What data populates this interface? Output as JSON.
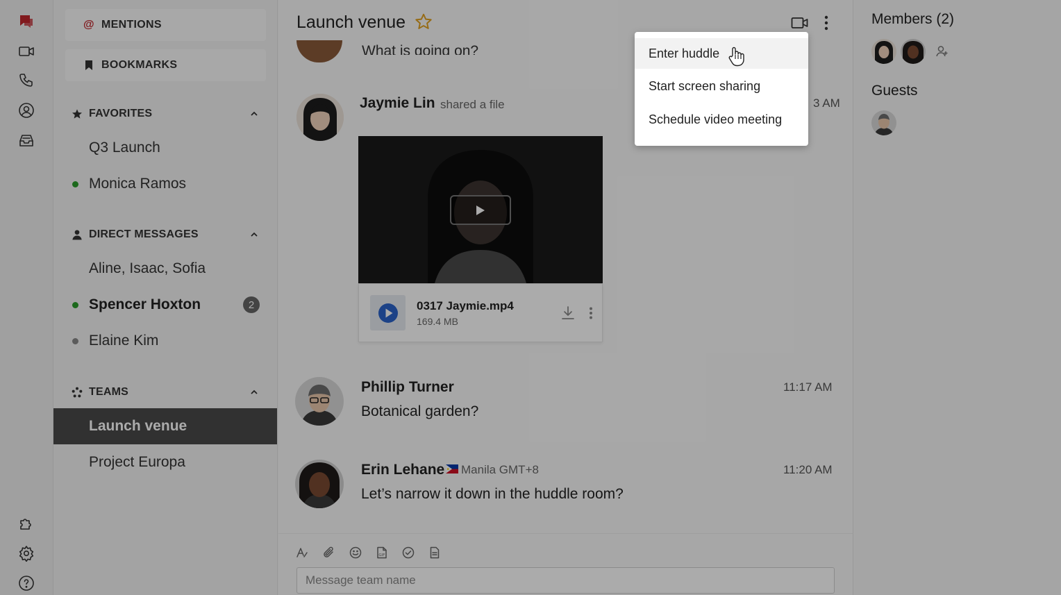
{
  "rail": {
    "icons": [
      "chat-icon",
      "video-icon",
      "phone-icon",
      "contacts-icon",
      "inbox-icon",
      "integrations-icon",
      "settings-icon",
      "help-icon"
    ],
    "accent": "#c0272d"
  },
  "sidebar": {
    "mentions": "MENTIONS",
    "bookmarks": "BOOKMARKS",
    "favorites": {
      "title": "FAVORITES",
      "items": [
        {
          "label": "Q3 Launch"
        },
        {
          "label": "Monica Ramos",
          "status": "#2a9d2a"
        }
      ]
    },
    "direct_messages": {
      "title": "DIRECT MESSAGES",
      "items": [
        {
          "label": "Aline, Isaac, Sofia"
        },
        {
          "label": "Spencer Hoxton",
          "status": "#2a9d2a",
          "badge": "2"
        },
        {
          "label": "Elaine Kim",
          "status": "#888888"
        }
      ]
    },
    "teams": {
      "title": "TEAMS",
      "items": [
        {
          "label": "Launch venue"
        },
        {
          "label": "Project Europa"
        }
      ]
    }
  },
  "channel": {
    "title": "Launch venue",
    "star_color": "#e0a020"
  },
  "messages": [
    {
      "text_partial": "What is going on?"
    },
    {
      "author": "Jaymie Lin",
      "action": "shared a file",
      "time_partial": "3 AM",
      "file": {
        "name": "0317 Jaymie.mp4",
        "size": "169.4 MB"
      }
    },
    {
      "author": "Phillip Turner",
      "time": "11:17 AM",
      "text": "Botanical garden?"
    },
    {
      "author": "Erin Lehane",
      "location": "Manila GMT+8",
      "time": "11:20 AM",
      "text": "Let’s narrow it down in the huddle room?"
    }
  ],
  "composer": {
    "placeholder": "Message team name",
    "tools": [
      "format-icon",
      "attach-icon",
      "emoji-icon",
      "gif-icon",
      "task-icon",
      "note-icon"
    ]
  },
  "right_panel": {
    "members_title": "Members (2)",
    "guests_title": "Guests"
  },
  "menu": {
    "items": [
      "Enter huddle",
      "Start screen sharing",
      "Schedule video meeting"
    ]
  }
}
